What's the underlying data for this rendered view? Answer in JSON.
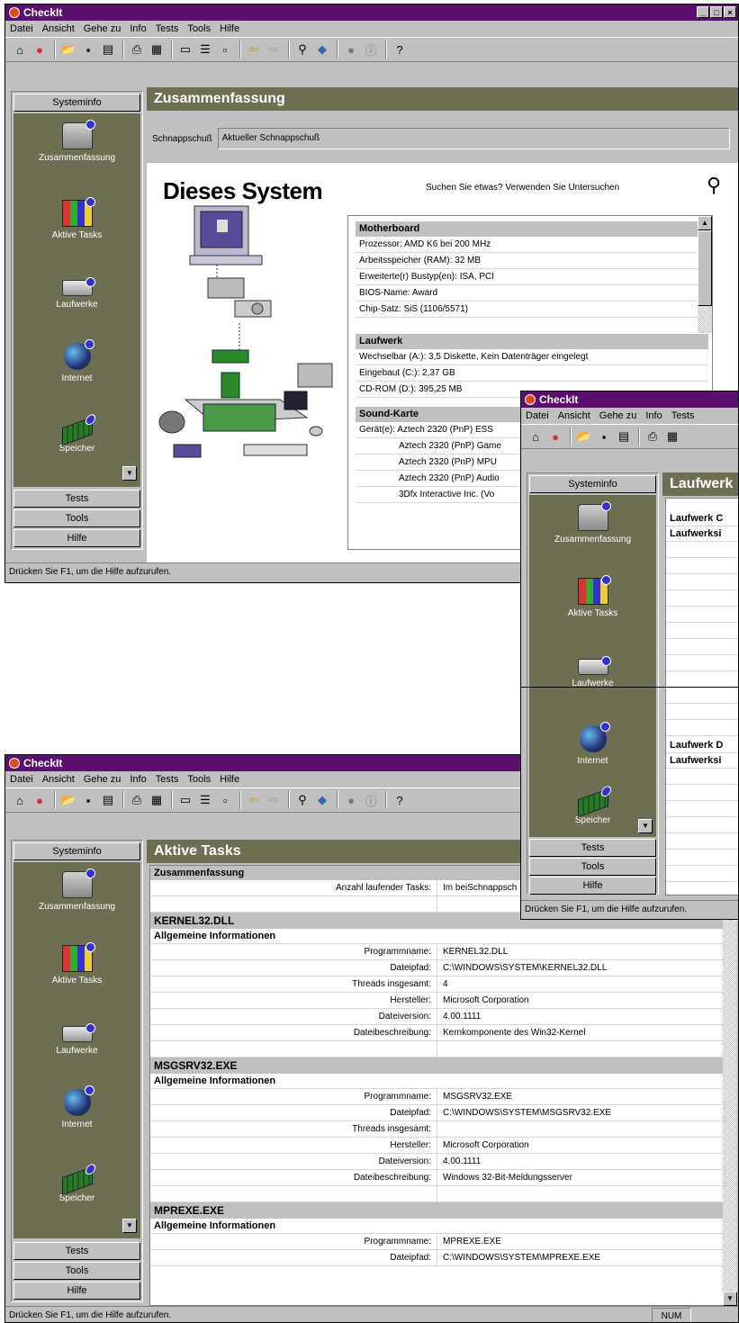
{
  "app": {
    "title": "CheckIt"
  },
  "window1": {
    "menu": [
      "Datei",
      "Ansicht",
      "Gehe zu",
      "Info",
      "Tests",
      "Tools",
      "Hilfe"
    ],
    "sidebar": {
      "header": "Systeminfo",
      "items": [
        {
          "label": "Zusammenfassung",
          "icon": "computer-icon"
        },
        {
          "label": "Aktive Tasks",
          "icon": "tasks-icon"
        },
        {
          "label": "Laufwerke",
          "icon": "drive-icon"
        },
        {
          "label": "Internet",
          "icon": "globe-icon"
        },
        {
          "label": "Speicher",
          "icon": "memory-icon"
        }
      ],
      "tabs": [
        "Tests",
        "Tools",
        "Hilfe"
      ]
    },
    "header": "Zusammenfassung",
    "snapshot_label": "Schnappschuß",
    "snapshot_value": "Aktueller Schnappschuß",
    "system_title": "Dieses System",
    "help_hint": "Suchen Sie etwas? Verwenden Sie Untersuchen",
    "sections": [
      {
        "title": "Motherboard",
        "rows": [
          "Prozessor: AMD K6 bei 200 MHz",
          "Arbeitsspeicher (RAM): 32 MB",
          "Erweiterte(r) Bustyp(en): ISA, PCI",
          "BIOS-Name: Award",
          "Chip-Satz: SiS (1106/5571)"
        ]
      },
      {
        "title": "Laufwerk",
        "rows": [
          "Wechselbar (A:): 3,5 Diskette, Kein Datenträger eingelegt",
          "Eingebaut (C:): 2,37 GB",
          "CD-ROM (D:): 395,25 MB"
        ]
      },
      {
        "title": "Sound-Karte",
        "rows": [
          "Gerät(e): Aztech 2320 (PnP) ESS",
          "Aztech 2320 (PnP) Game",
          "Aztech 2320 (PnP) MPU",
          "Aztech 2320 (PnP) Audio",
          "3Dfx Interactive Inc. (Vo"
        ]
      }
    ],
    "status": "Drücken Sie F1, um die Hilfe aufzurufen."
  },
  "window2": {
    "menu": [
      "Datei",
      "Ansicht",
      "Gehe zu",
      "Info",
      "Tests"
    ],
    "sidebar": {
      "header": "Systeminfo",
      "items": [
        {
          "label": "Zusammenfassung",
          "icon": "computer-icon"
        },
        {
          "label": "Aktive Tasks",
          "icon": "tasks-icon"
        },
        {
          "label": "Laufwerke",
          "icon": "drive-icon"
        },
        {
          "label": "Internet",
          "icon": "globe-icon"
        },
        {
          "label": "Speicher",
          "icon": "memory-icon"
        }
      ],
      "tabs": [
        "Tests",
        "Tools",
        "Hilfe"
      ]
    },
    "header": "Laufwerk",
    "block1_title": "Laufwerk C",
    "block1_sub": "Laufwerksi",
    "block2_title": "Laufwerk D",
    "block2_sub": "Laufwerksi",
    "status": "Drücken Sie F1, um die Hilfe aufzurufen."
  },
  "window3": {
    "menu": [
      "Datei",
      "Ansicht",
      "Gehe zu",
      "Info",
      "Tests",
      "Tools",
      "Hilfe"
    ],
    "sidebar": {
      "header": "Systeminfo",
      "items": [
        {
          "label": "Zusammenfassung",
          "icon": "computer-icon"
        },
        {
          "label": "Aktive Tasks",
          "icon": "tasks-icon"
        },
        {
          "label": "Laufwerke",
          "icon": "drive-icon"
        },
        {
          "label": "Internet",
          "icon": "globe-icon"
        },
        {
          "label": "Speicher",
          "icon": "memory-icon"
        }
      ],
      "tabs": [
        "Tests",
        "Tools",
        "Hilfe"
      ]
    },
    "header": "Aktive Tasks",
    "summary": {
      "title": "Zusammenfassung",
      "key": "Anzahl laufender Tasks:",
      "value": "Im beiSchnappsch"
    },
    "tasks": [
      {
        "name": "KERNEL32.DLL",
        "sub": "Allgemeine Informationen",
        "rows": [
          {
            "k": "Programmname:",
            "v": "KERNEL32.DLL"
          },
          {
            "k": "Dateipfad:",
            "v": "C:\\WINDOWS\\SYSTEM\\KERNEL32.DLL"
          },
          {
            "k": "Threads insgesamt:",
            "v": "4"
          },
          {
            "k": "Hersteller:",
            "v": "Microsoft Corporation"
          },
          {
            "k": "Dateiversion:",
            "v": "4.00.1111"
          },
          {
            "k": "Dateibeschreibung:",
            "v": "Kernkomponente des Win32-Kernel"
          }
        ]
      },
      {
        "name": "MSGSRV32.EXE",
        "sub": "Allgemeine Informationen",
        "rows": [
          {
            "k": "Programmname:",
            "v": "MSGSRV32.EXE"
          },
          {
            "k": "Dateipfad:",
            "v": "C:\\WINDOWS\\SYSTEM\\MSGSRV32.EXE"
          },
          {
            "k": "Threads insgesamt:",
            "v": ""
          },
          {
            "k": "Hersteller:",
            "v": "Microsoft Corporation"
          },
          {
            "k": "Dateiversion:",
            "v": "4.00.1111"
          },
          {
            "k": "Dateibeschreibung:",
            "v": "Windows 32-Bit-Meldungsserver"
          }
        ]
      },
      {
        "name": "MPREXE.EXE",
        "sub": "Allgemeine Informationen",
        "rows": [
          {
            "k": "Programmname:",
            "v": "MPREXE.EXE"
          },
          {
            "k": "Dateipfad:",
            "v": "C:\\WINDOWS\\SYSTEM\\MPREXE.EXE"
          }
        ]
      }
    ],
    "status": "Drücken Sie F1, um die Hilfe aufzurufen.",
    "num_indicator": "NUM"
  }
}
